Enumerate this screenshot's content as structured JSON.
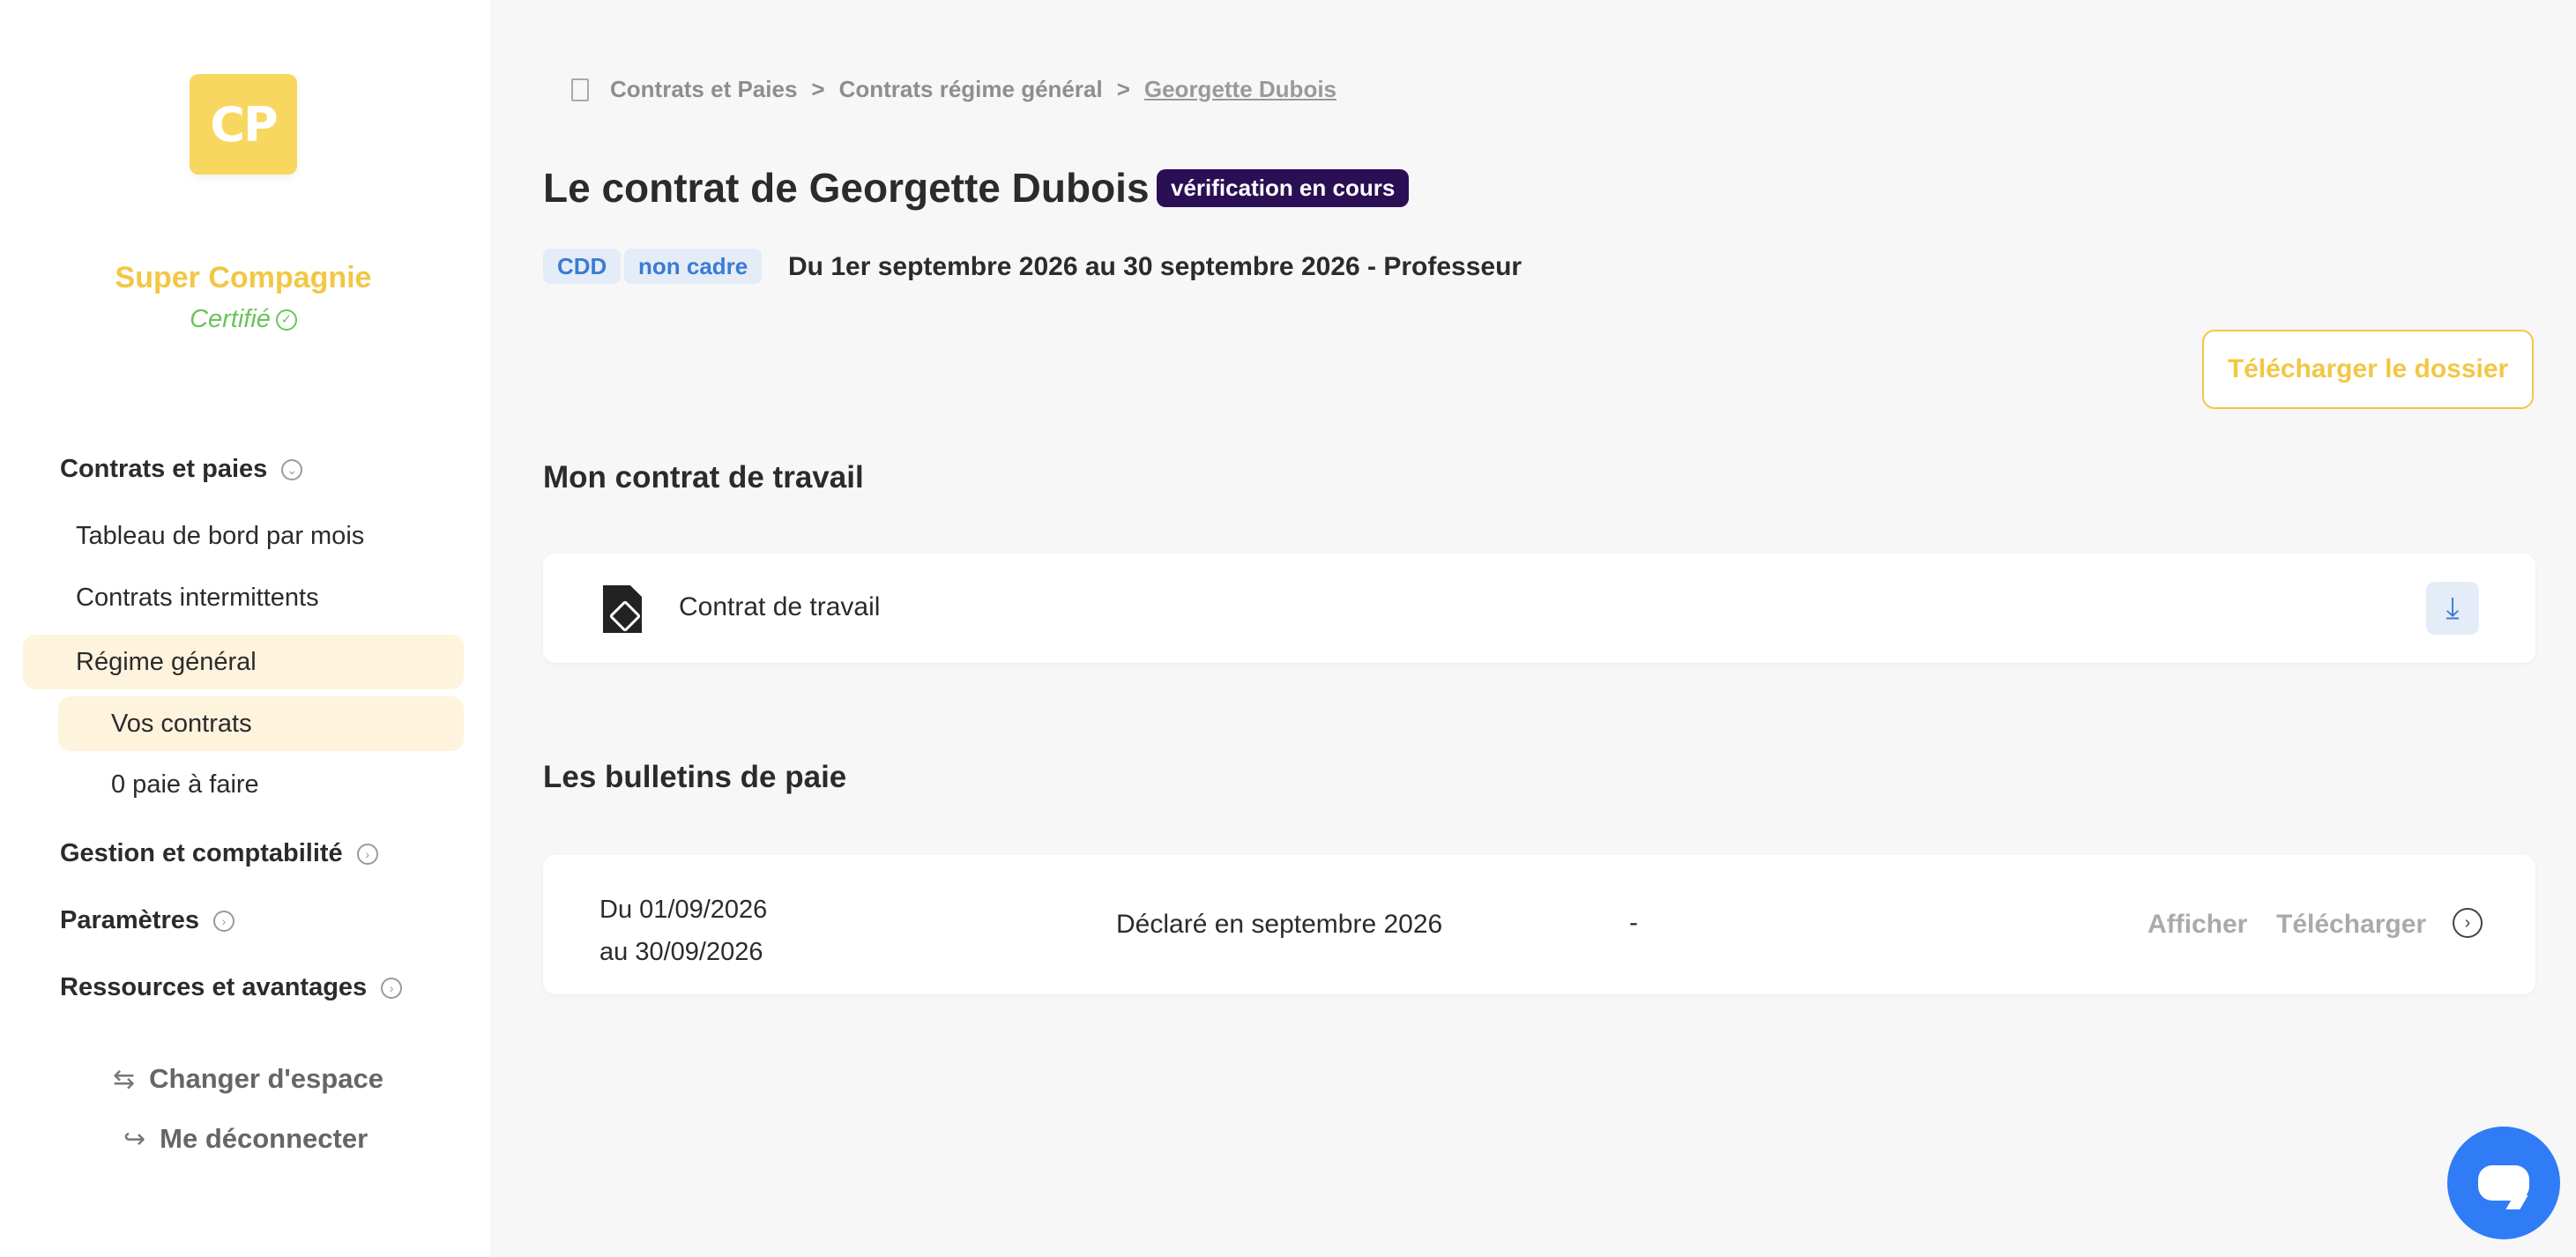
{
  "sidebar": {
    "logo_text": "CP",
    "company_name": "Super Compagnie",
    "certified": "Certifié",
    "sections": {
      "contracts": "Contrats et paies",
      "management": "Gestion et comptabilité",
      "settings": "Paramètres",
      "resources": "Ressources et avantages"
    },
    "items": {
      "dashboard": "Tableau de bord par mois",
      "intermittent": "Contrats intermittents",
      "general": "Régime général",
      "your_contracts": "Vos contrats",
      "pay_todo": "0 paie à faire"
    },
    "switch_space": "Changer d'espace",
    "logout": "Me déconnecter"
  },
  "breadcrumb": {
    "level1": "Contrats et Paies",
    "level2": "Contrats régime général",
    "current": "Georgette Dubois",
    "separator": ">"
  },
  "header": {
    "title": "Le contrat de Georgette Dubois",
    "status": "vérification en cours",
    "tags": [
      "CDD",
      "non cadre"
    ],
    "period": "Du 1er septembre 2026 au 30 septembre 2026 - Professeur",
    "download_folder": "Télécharger le dossier"
  },
  "contract_section": {
    "heading": "Mon contrat de travail",
    "doc_label": "Contrat de travail"
  },
  "payslips": {
    "heading": "Les bulletins de paie",
    "rows": [
      {
        "from": "Du 01/09/2026",
        "to": "au 30/09/2026",
        "declared": "Déclaré en septembre 2026",
        "amount": "-",
        "view": "Afficher",
        "download": "Télécharger"
      }
    ]
  },
  "colors": {
    "brand_yellow": "#f2c744",
    "status_badge": "#2a0f55",
    "tag_blue": "#3a7bd5",
    "chat_blue": "#2f7cf6"
  }
}
